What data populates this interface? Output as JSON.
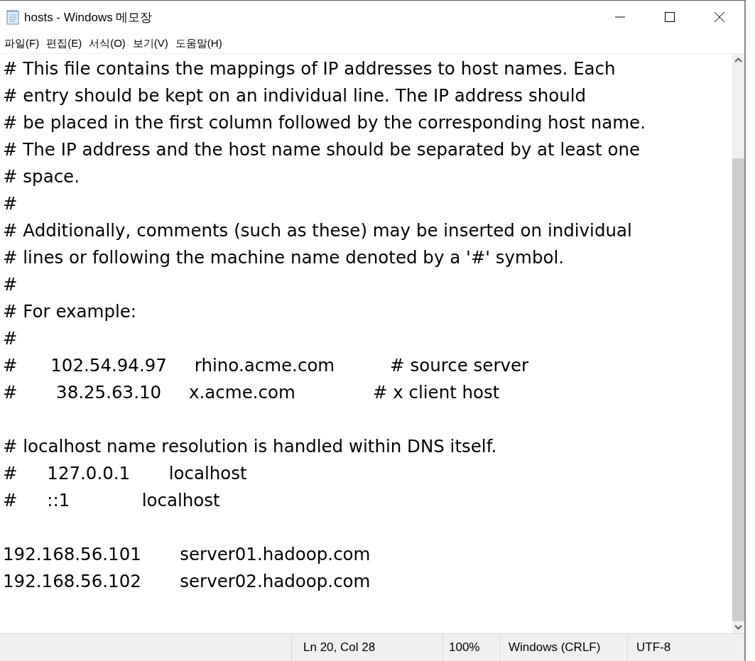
{
  "window": {
    "title": "hosts - Windows 메모장"
  },
  "menu": [
    "파일(F)",
    "편집(E)",
    "서식(O)",
    "보기(V)",
    "도움말(H)"
  ],
  "editor": {
    "blocks": [
      [
        "# This file contains the mappings of IP addresses to host names. Each",
        "# entry should be kept on an individual line. The IP address should",
        "# be placed in the first column followed by the corresponding host name.",
        "# The IP address and the host name should be separated by at least one",
        "# space.",
        "#",
        "# Additionally, comments (such as these) may be inserted on individual",
        "# lines or following the machine name denoted by a '#' symbol.",
        "#",
        "# For example:",
        "#",
        "#      102.54.94.97     rhino.acme.com          # source server",
        "#       38.25.63.10     x.acme.com              # x client host"
      ],
      [
        "# localhost name resolution is handled within DNS itself.",
        "#\t127.0.0.1       localhost",
        "#\t::1             localhost"
      ],
      [
        "192.168.56.101\tserver01.hadoop.com",
        "192.168.56.102\tserver02.hadoop.com"
      ]
    ]
  },
  "status_bar": [
    "Ln 20, Col 28",
    "100%",
    "Windows (CRLF)",
    "UTF-8"
  ]
}
